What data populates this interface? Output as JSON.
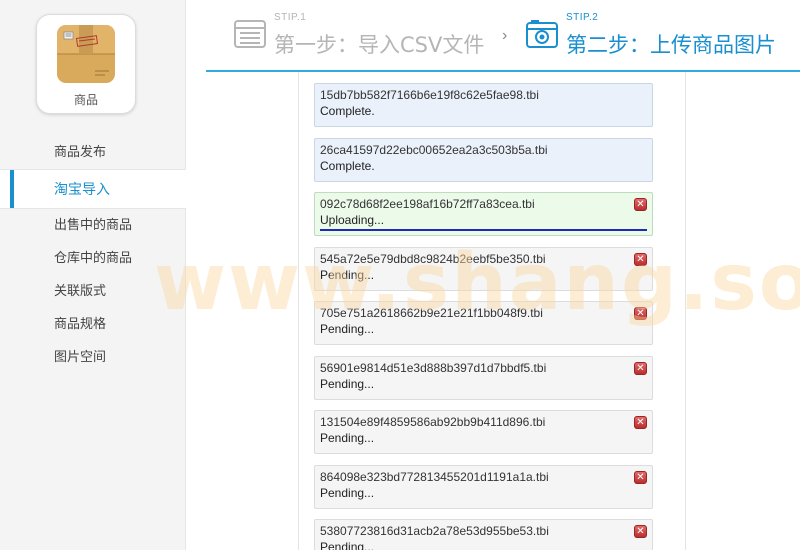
{
  "sidebar": {
    "app_label": "商品",
    "app_icon": "cardboard-box-icon",
    "items": [
      {
        "label": "商品发布",
        "active": false
      },
      {
        "label": "淘宝导入",
        "active": true
      },
      {
        "label": "出售中的商品",
        "active": false
      },
      {
        "label": "仓库中的商品",
        "active": false
      },
      {
        "label": "关联版式",
        "active": false
      },
      {
        "label": "商品规格",
        "active": false
      },
      {
        "label": "图片空间",
        "active": false
      }
    ]
  },
  "steps": [
    {
      "small": "STIP.1",
      "title": "第一步：导入CSV文件",
      "icon": "list-icon",
      "state": "done"
    },
    {
      "small": "STIP.2",
      "title": "第二步：上传商品图片",
      "icon": "camera-icon",
      "state": "current"
    }
  ],
  "steps_arrow": "›",
  "uploads": [
    {
      "file": "15db7bb582f7166b6e19f8c62e5fae98.tbi",
      "status": "Complete.",
      "state": "complete"
    },
    {
      "file": "26ca41597d22ebc00652ea2a3c503b5a.tbi",
      "status": "Complete.",
      "state": "complete"
    },
    {
      "file": "092c78d68f2ee198af16b72ff7a83cea.tbi",
      "status": "Uploading...",
      "state": "uploading",
      "progress": 1.0
    },
    {
      "file": "545a72e5e79dbd8c9824b2eebf5be350.tbi",
      "status": "Pending...",
      "state": "pending"
    },
    {
      "file": "705e751a2618662b9e21e21f1bb048f9.tbi",
      "status": "Pending...",
      "state": "pending"
    },
    {
      "file": "56901e9814d51e3d888b397d1d7bbdf5.tbi",
      "status": "Pending...",
      "state": "pending"
    },
    {
      "file": "131504e89f4859586ab92bb9b411d896.tbi",
      "status": "Pending...",
      "state": "pending"
    },
    {
      "file": "864098e323bd772813455201d1191a1a.tbi",
      "status": "Pending...",
      "state": "pending"
    },
    {
      "file": "53807723816d31acb2a78e53d955be53.tbi",
      "status": "Pending...",
      "state": "pending"
    }
  ],
  "cancel_icon": "cancel-x-icon",
  "watermark": "www.shang.so",
  "colors": {
    "accent": "#1a8fd0",
    "complete_bg": "#eaf1fb",
    "uploading_bg": "#ecfaea",
    "pending_bg": "#f5f5f5",
    "progress_bar": "#1f2bb8",
    "cancel_red": "#c73a3a"
  }
}
